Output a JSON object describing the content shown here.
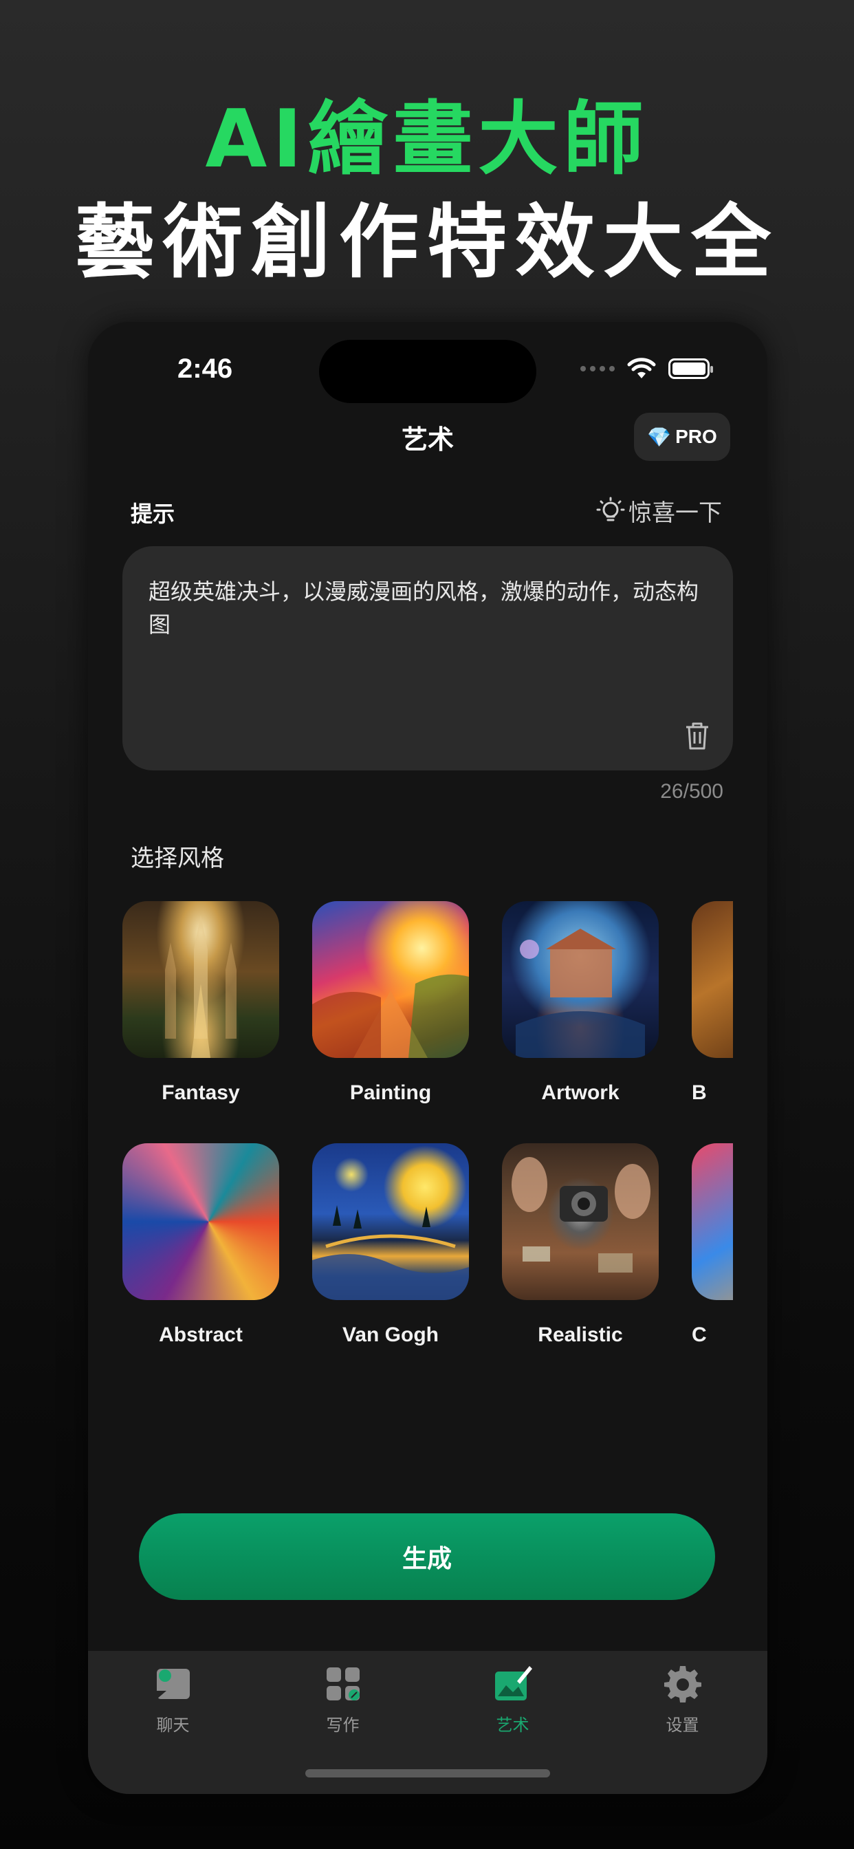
{
  "promo": {
    "headline_line1": "AI繪畫大師",
    "headline_line2": "藝術創作特效大全"
  },
  "status_bar": {
    "time": "2:46"
  },
  "header": {
    "title": "艺术",
    "pro_label": "PRO",
    "pro_icon": "diamond-icon"
  },
  "prompt": {
    "label": "提示",
    "surprise_label": "惊喜一下",
    "text": "超级英雄决斗，以漫威漫画的风格，激爆的动作，动态构图",
    "char_count": "26/500"
  },
  "styles": {
    "label": "选择风格",
    "row1": [
      {
        "name": "Fantasy"
      },
      {
        "name": "Painting"
      },
      {
        "name": "Artwork"
      },
      {
        "name": "B"
      }
    ],
    "row2": [
      {
        "name": "Abstract"
      },
      {
        "name": "Van Gogh"
      },
      {
        "name": "Realistic"
      },
      {
        "name": "C"
      }
    ]
  },
  "generate_button": "生成",
  "tabbar": {
    "items": [
      {
        "label": "聊天",
        "icon": "chat-icon",
        "active": false
      },
      {
        "label": "写作",
        "icon": "writing-grid-icon",
        "active": false
      },
      {
        "label": "艺术",
        "icon": "art-canvas-icon",
        "active": true
      },
      {
        "label": "设置",
        "icon": "gear-icon",
        "active": false
      }
    ]
  },
  "colors": {
    "accent_green": "#26d861",
    "button_green": "#07814f",
    "active_tab": "#1aa870",
    "background": "#141414"
  }
}
